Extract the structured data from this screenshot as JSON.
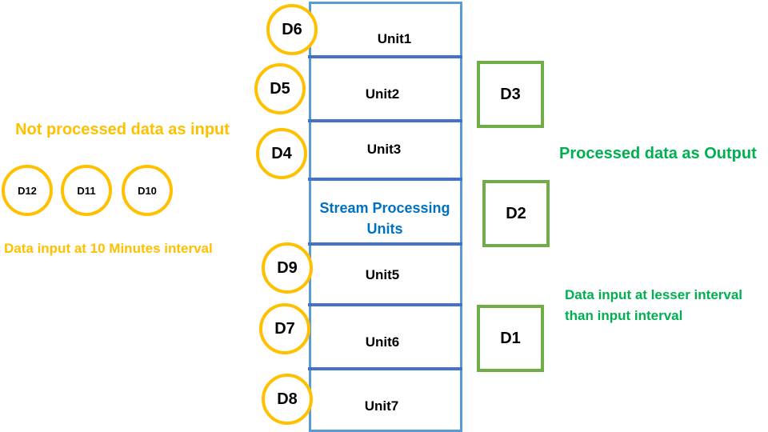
{
  "colors": {
    "input": "#ffc000",
    "output": "#00b050",
    "box_border": "#5b9bd5",
    "divider": "#4472c4",
    "square_border": "#70ad47",
    "title": "#0070c0"
  },
  "units": [
    "Unit1",
    "Unit2",
    "Unit3",
    "Unit5",
    "Unit6",
    "Unit7"
  ],
  "processing_label_line1": "Stream Processing",
  "processing_label_line2": "Units",
  "stream_circles": [
    "D6",
    "D5",
    "D4",
    "D9",
    "D7",
    "D8"
  ],
  "input_circles": [
    "D12",
    "D11",
    "D10"
  ],
  "output_squares": [
    "D3",
    "D2",
    "D1"
  ],
  "input_title": "Not processed data as input",
  "input_interval": "Data input at 10 Minutes interval",
  "output_title": "Processed data as Output",
  "output_interval_line1": "Data input at lesser interval",
  "output_interval_line2": "than input interval"
}
